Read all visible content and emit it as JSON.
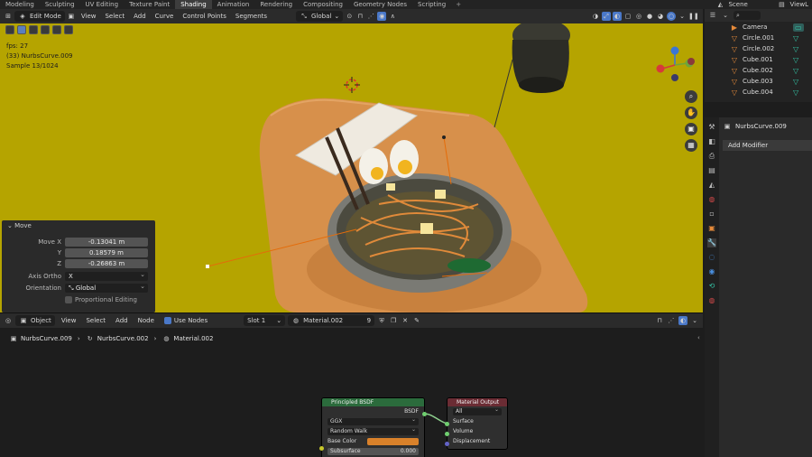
{
  "workspaces": [
    "Modeling",
    "Sculpting",
    "UV Editing",
    "Texture Paint",
    "Shading",
    "Animation",
    "Rendering",
    "Compositing",
    "Geometry Nodes",
    "Scripting"
  ],
  "active_workspace": "Shading",
  "scene_name": "Scene",
  "view_layer": "ViewL",
  "viewport_header": {
    "mode": "Edit Mode",
    "menus": [
      "View",
      "Select",
      "Add",
      "Curve",
      "Control Points",
      "Segments"
    ],
    "transform_orientation": "Global"
  },
  "viewport": {
    "stats": [
      "fps: 27",
      "(33) NurbsCurve.009",
      "Sample 13/1024"
    ],
    "background_color": "#b5a400"
  },
  "move_panel": {
    "title": "Move",
    "move_x_label": "Move X",
    "move_x": "-0.13041 m",
    "y_label": "Y",
    "y": "0.18579 m",
    "z_label": "Z",
    "z": "-0.26863 m",
    "axis_ortho_label": "Axis Ortho",
    "axis_ortho": "X",
    "orientation_label": "Orientation",
    "orientation": "Global",
    "proportional_label": "Proportional Editing"
  },
  "node_header": {
    "mode": "Object",
    "menus": [
      "View",
      "Select",
      "Add",
      "Node"
    ],
    "use_nodes_label": "Use Nodes",
    "slot": "Slot 1",
    "material": "Material.002",
    "users": "9"
  },
  "breadcrumb": [
    "NurbsCurve.009",
    "NurbsCurve.002",
    "Material.002"
  ],
  "nodes": {
    "principled": {
      "title": "Principled BSDF",
      "output": "BSDF",
      "distribution": "GGX",
      "subsurface_method": "Random Walk",
      "base_color_label": "Base Color",
      "base_color": "#d9812a",
      "next_label": "Subsurface",
      "next_value": "0.000"
    },
    "output": {
      "title": "Material Output",
      "target": "All",
      "inputs": [
        "Surface",
        "Volume",
        "Displacement"
      ]
    }
  },
  "outliner": {
    "items": [
      {
        "name": "Camera",
        "icon": "camera-icon"
      },
      {
        "name": "Circle.001",
        "icon": "curve-icon"
      },
      {
        "name": "Circle.002",
        "icon": "curve-icon"
      },
      {
        "name": "Cube.001",
        "icon": "mesh-icon"
      },
      {
        "name": "Cube.002",
        "icon": "mesh-icon"
      },
      {
        "name": "Cube.003",
        "icon": "mesh-icon"
      },
      {
        "name": "Cube.004",
        "icon": "mesh-icon"
      }
    ]
  },
  "properties": {
    "object_name": "NurbsCurve.009",
    "add_modifier_label": "Add Modifier"
  }
}
